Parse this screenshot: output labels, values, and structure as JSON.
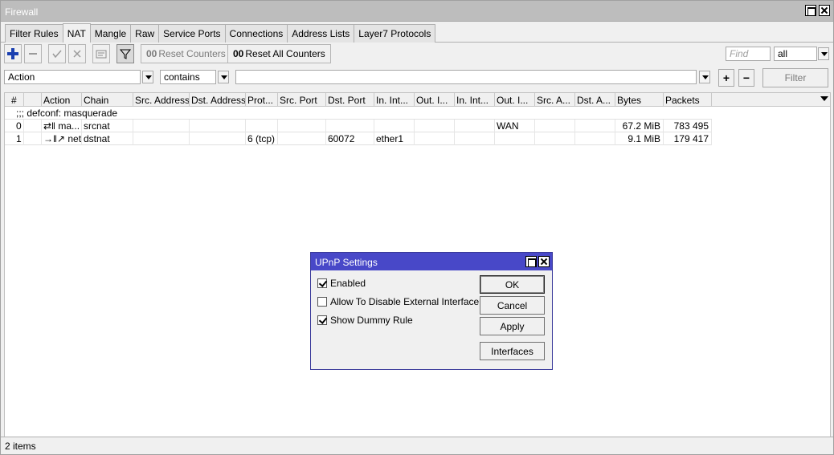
{
  "window": {
    "title": "Firewall"
  },
  "tabs": [
    "Filter Rules",
    "NAT",
    "Mangle",
    "Raw",
    "Service Ports",
    "Connections",
    "Address Lists",
    "Layer7 Protocols"
  ],
  "active_tab": "NAT",
  "toolbar": {
    "reset_counters": "Reset Counters",
    "reset_all_counters": "Reset All Counters",
    "counter_prefix": "00",
    "find_placeholder": "Find",
    "scope_value": "all"
  },
  "filter": {
    "field": "Action",
    "operator": "contains",
    "value": "",
    "button": "Filter"
  },
  "table": {
    "columns": [
      "#",
      "",
      "Action",
      "Chain",
      "Src. Address",
      "Dst. Address",
      "Prot...",
      "Src. Port",
      "Dst. Port",
      "In. Int...",
      "Out. I...",
      "In. Int...",
      "Out. I...",
      "Src. A...",
      "Dst. A...",
      "Bytes",
      "Packets"
    ],
    "comment": ";;; defconf: masquerade",
    "rows": [
      {
        "num": "0",
        "action_icon": "⇄‖",
        "action": "ma...",
        "chain": "srcnat",
        "src_address": "",
        "dst_address": "",
        "protocol": "",
        "src_port": "",
        "dst_port": "",
        "in_interface": "",
        "out_interface": "",
        "in_interface_list": "",
        "out_interface_list": "WAN",
        "src_address_list": "",
        "dst_address_list": "",
        "bytes": "67.2 MiB",
        "packets": "783 495"
      },
      {
        "num": "1",
        "action_icon": "→‖↗",
        "action": "net...",
        "chain": "dstnat",
        "src_address": "",
        "dst_address": "",
        "protocol": "6 (tcp)",
        "src_port": "",
        "dst_port": "60072",
        "in_interface": "ether1",
        "out_interface": "",
        "in_interface_list": "",
        "out_interface_list": "",
        "src_address_list": "",
        "dst_address_list": "",
        "bytes": "9.1 MiB",
        "packets": "179 417"
      }
    ]
  },
  "status": {
    "items": "2 items"
  },
  "dialog": {
    "title": "UPnP Settings",
    "options": [
      {
        "label": "Enabled",
        "checked": true
      },
      {
        "label": "Allow To Disable External Interface",
        "checked": false
      },
      {
        "label": "Show Dummy Rule",
        "checked": true
      }
    ],
    "buttons": {
      "ok": "OK",
      "cancel": "Cancel",
      "apply": "Apply",
      "interfaces": "Interfaces"
    }
  },
  "colors": {
    "dialog_title_bg": "#4848c8",
    "add_icon": "#1a3fb0",
    "window_title_bg": "#bdbdbd"
  }
}
